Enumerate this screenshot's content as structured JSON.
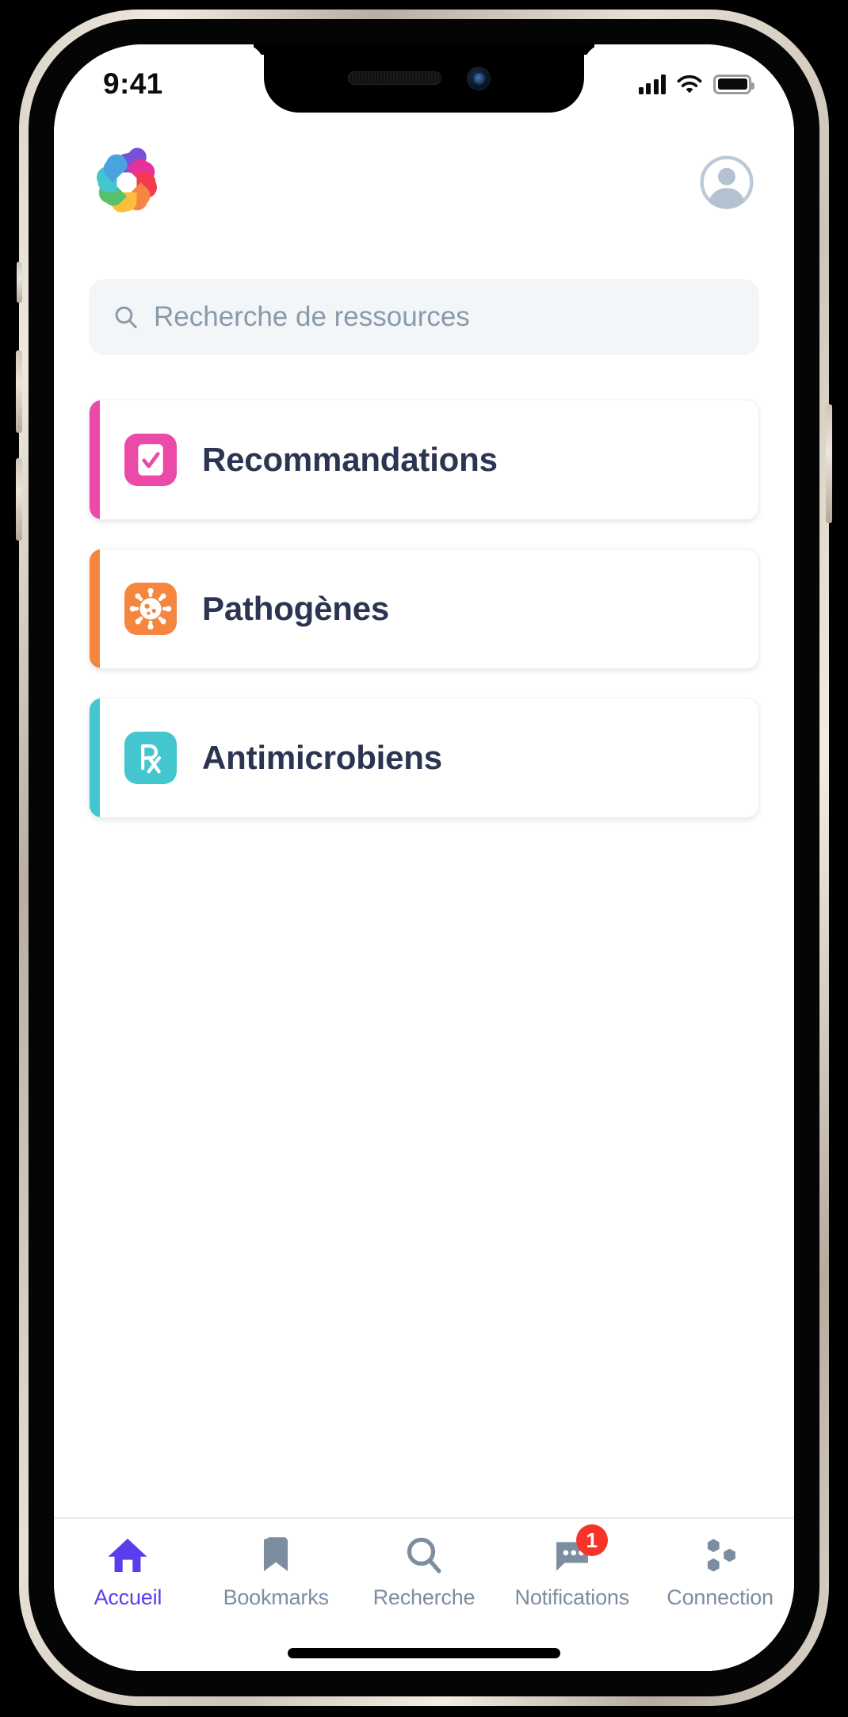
{
  "status_bar": {
    "time": "9:41",
    "signal_icon": "cellular-signal-icon",
    "wifi_icon": "wifi-icon",
    "battery_icon": "battery-full-icon"
  },
  "header": {
    "logo_icon": "app-logo-pinwheel-icon",
    "avatar_icon": "user-avatar-icon"
  },
  "search": {
    "icon": "search-icon",
    "placeholder": "Recherche de ressources",
    "value": ""
  },
  "categories": [
    {
      "label": "Recommandations",
      "icon": "checkbox-checked-icon",
      "accent_color": "#ec4aa8",
      "icon_bg": "#ec4aa8"
    },
    {
      "label": "Pathogènes",
      "icon": "pathogen-virus-icon",
      "accent_color": "#f5853f",
      "icon_bg": "#f5853f"
    },
    {
      "label": "Antimicrobiens",
      "icon": "prescription-rx-icon",
      "accent_color": "#43c6cd",
      "icon_bg": "#43c6cd"
    }
  ],
  "tab_bar": {
    "active_color": "#5b3df0",
    "inactive_color": "#7d8da0",
    "badge_color": "#f8342a",
    "items": [
      {
        "label": "Accueil",
        "icon": "home-icon",
        "active": true,
        "badge": ""
      },
      {
        "label": "Bookmarks",
        "icon": "bookmark-icon",
        "active": false,
        "badge": ""
      },
      {
        "label": "Recherche",
        "icon": "search-icon",
        "active": false,
        "badge": ""
      },
      {
        "label": "Notifications",
        "icon": "chat-bubble-icon",
        "active": false,
        "badge": "1"
      },
      {
        "label": "Connection",
        "icon": "network-nodes-icon",
        "active": false,
        "badge": ""
      }
    ]
  }
}
